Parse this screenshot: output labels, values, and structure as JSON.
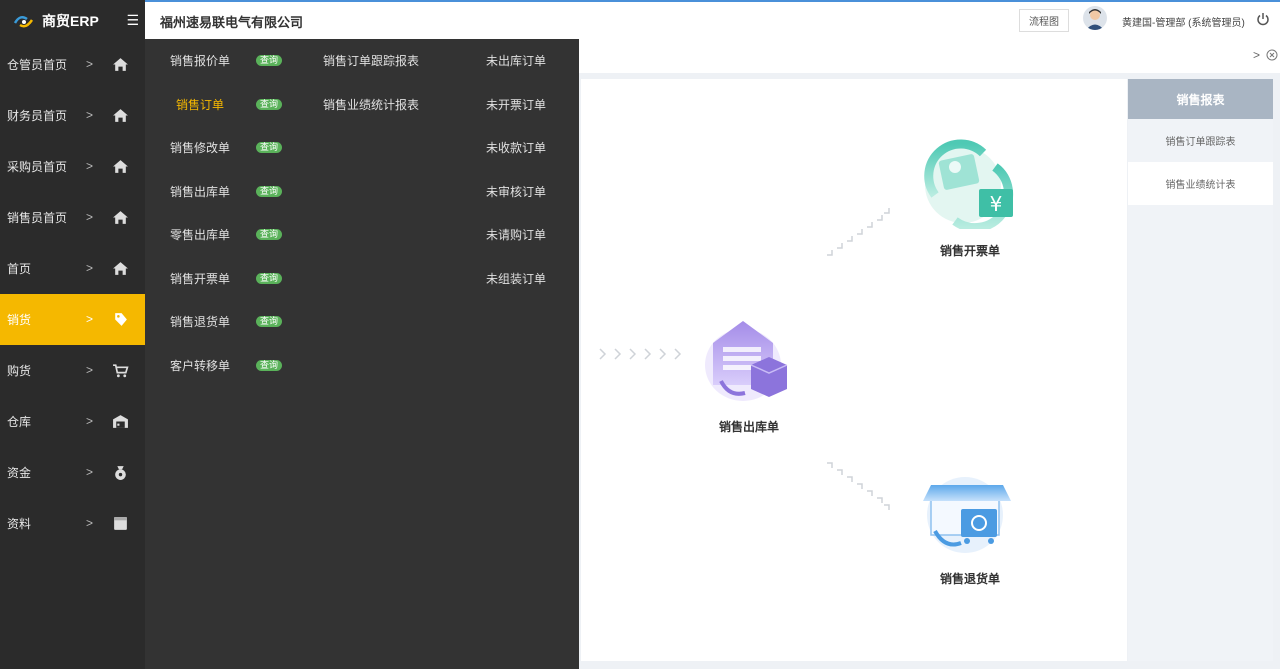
{
  "brand": {
    "name": "商贸ERP"
  },
  "header": {
    "company": "福州速易联电气有限公司",
    "flow_button": "流程图",
    "user": "黄建国-管理部 (系统管理员)"
  },
  "sidebar": {
    "items": [
      {
        "label": "仓管员首页",
        "icon": "home-icon"
      },
      {
        "label": "财务员首页",
        "icon": "home-icon"
      },
      {
        "label": "采购员首页",
        "icon": "home-icon"
      },
      {
        "label": "销售员首页",
        "icon": "home-icon"
      },
      {
        "label": "首页",
        "icon": "home-icon"
      },
      {
        "label": "销货",
        "icon": "tag-icon",
        "active": true
      },
      {
        "label": "购货",
        "icon": "cart-icon"
      },
      {
        "label": "仓库",
        "icon": "warehouse-icon"
      },
      {
        "label": "资金",
        "icon": "money-bag-icon"
      },
      {
        "label": "资料",
        "icon": "folder-icon"
      }
    ]
  },
  "submenu": {
    "tag_label": "查询",
    "col1": [
      "销售报价单",
      "销售订单",
      "销售修改单",
      "销售出库单",
      "零售出库单",
      "销售开票单",
      "销售退货单",
      "客户转移单"
    ],
    "col2": [
      "销售订单跟踪报表",
      "销售业绩统计报表"
    ],
    "col3": [
      "未出库订单",
      "未开票订单",
      "未收款订单",
      "未审核订单",
      "未请购订单",
      "未组装订单"
    ]
  },
  "flow": {
    "out": "销售出库单",
    "invoice": "销售开票单",
    "return": "销售退货单"
  },
  "right_panel": {
    "title": "销售报表",
    "items": [
      "销售订单跟踪表",
      "销售业绩统计表"
    ]
  },
  "colors": {
    "accent": "#f5b800",
    "sidebar_bg": "#2b2b2b",
    "tag_green": "#5ab25a"
  }
}
